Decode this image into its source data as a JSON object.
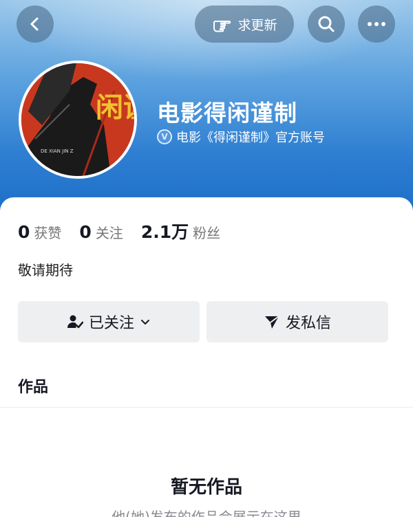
{
  "header": {
    "request_update_label": "求更新",
    "gradient_top": "#9cc8ea",
    "gradient_bottom": "#1b6cc8"
  },
  "profile": {
    "name": "电影得闲谨制",
    "verified_text": "电影《得闲谨制》官方账号",
    "avatar_text": "闲谨",
    "avatar_caption": "DE XIAN JIN Z",
    "avatar_colors": {
      "background": "#c8381f",
      "figure": "#1a1a1a",
      "letters": "#f2c12e"
    }
  },
  "stats": [
    {
      "value": "0",
      "label": "获赞"
    },
    {
      "value": "0",
      "label": "关注"
    },
    {
      "value": "2.1万",
      "label": "粉丝"
    }
  ],
  "bio": "敬请期待",
  "actions": {
    "follow_label": "已关注",
    "message_label": "发私信"
  },
  "works": {
    "section_title": "作品",
    "empty_title": "暂无作品",
    "empty_subtitle": "他(她)发布的作品会展示在这里"
  }
}
